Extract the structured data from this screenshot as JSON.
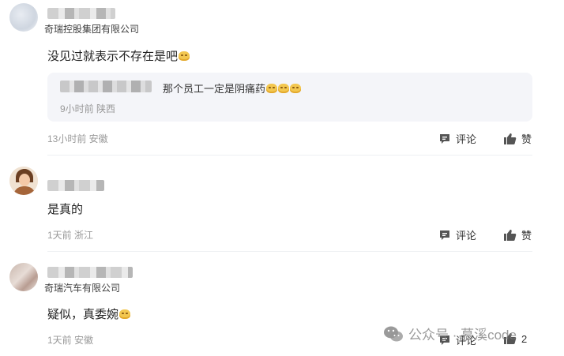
{
  "comments": [
    {
      "company": "奇瑞控股集团有限公司",
      "text": "没见过就表示不存在是吧",
      "reply": {
        "text": "那个员工一定是阴痛药",
        "time": "9小时前 陕西"
      },
      "time": "13小时前 安徽",
      "comment_label": "评论",
      "like_label": "赞"
    },
    {
      "company": "",
      "text": "是真的",
      "time": "1天前 浙江",
      "comment_label": "评论",
      "like_label": "赞"
    },
    {
      "company": "奇瑞汽车有限公司",
      "text": "疑似，真委婉",
      "time": "1天前 安徽",
      "comment_label": "评论",
      "like_label": "2"
    }
  ],
  "watermark": {
    "text": "公众号 · 慕溪code"
  },
  "icons": {
    "comment": "comment-icon",
    "like": "thumbs-up-icon",
    "emoji": "emoji-icon",
    "wechat": "wechat-icon"
  }
}
